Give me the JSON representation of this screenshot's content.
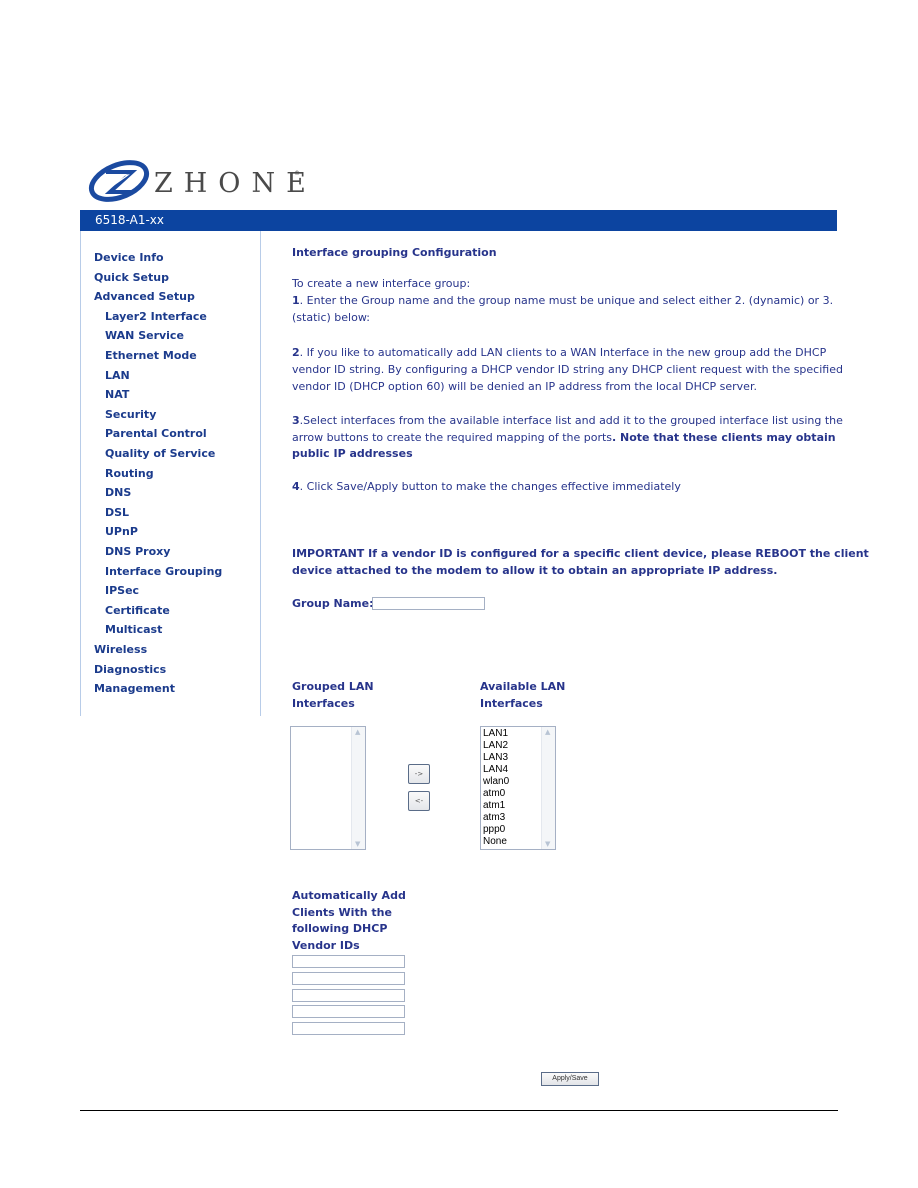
{
  "brand": {
    "name": "ZHONE",
    "reg_mark": "®"
  },
  "header": {
    "model": "6518-A1-xx"
  },
  "sidebar": {
    "items": [
      {
        "label": "Device Info",
        "level": 0
      },
      {
        "label": "Quick Setup",
        "level": 0
      },
      {
        "label": "Advanced Setup",
        "level": 0
      },
      {
        "label": "Layer2 Interface",
        "level": 1
      },
      {
        "label": "WAN Service",
        "level": 1
      },
      {
        "label": "Ethernet Mode",
        "level": 1
      },
      {
        "label": "LAN",
        "level": 1
      },
      {
        "label": "NAT",
        "level": 1
      },
      {
        "label": "Security",
        "level": 1
      },
      {
        "label": "Parental Control",
        "level": 1
      },
      {
        "label": "Quality of Service",
        "level": 1
      },
      {
        "label": "Routing",
        "level": 1
      },
      {
        "label": "DNS",
        "level": 1
      },
      {
        "label": "DSL",
        "level": 1
      },
      {
        "label": "UPnP",
        "level": 1
      },
      {
        "label": "DNS Proxy",
        "level": 1
      },
      {
        "label": "Interface Grouping",
        "level": 1
      },
      {
        "label": "IPSec",
        "level": 1
      },
      {
        "label": "Certificate",
        "level": 1
      },
      {
        "label": "Multicast",
        "level": 1
      },
      {
        "label": "Wireless",
        "level": 0
      },
      {
        "label": "Diagnostics",
        "level": 0
      },
      {
        "label": "Management",
        "level": 0
      }
    ]
  },
  "main": {
    "title": "Interface grouping Configuration",
    "intro": "To create a new interface group:",
    "step1": {
      "num": "1",
      "line1": ". Enter the Group name and the group name must be unique and select either 2. (dynamic) or 3.",
      "line2": "(static) below:"
    },
    "step2": {
      "num": "2",
      "line1": ". If you like to automatically add LAN clients to a WAN Interface in the new group add the DHCP",
      "line2": "vendor ID string. By configuring a DHCP vendor ID string any DHCP client request with the specified",
      "line3": "vendor ID (DHCP option 60) will be denied an IP address from the local DHCP server."
    },
    "step3": {
      "num": "3",
      "line1": ".Select interfaces from the available interface list and add it to the grouped interface list using the",
      "line2_plain": "arrow buttons to create the required mapping of the ports",
      "line2_bold": ". Note that these clients may obtain",
      "line3_bold": "public IP addresses"
    },
    "step4": {
      "num": "4",
      "line1": ". Click Save/Apply button to make the changes effective immediately"
    },
    "important": {
      "line1": "IMPORTANT If a vendor ID is configured for a specific client device, please REBOOT the client",
      "line2": "device attached to the modem to allow it to obtain an appropriate IP address."
    },
    "group_name": {
      "label": "Group Name:",
      "value": ""
    },
    "grouped": {
      "label1": "Grouped LAN",
      "label2": "Interfaces",
      "options": []
    },
    "available": {
      "label1": "Available LAN",
      "label2": "Interfaces",
      "options": [
        "LAN1",
        "LAN2",
        "LAN3",
        "LAN4",
        "wlan0",
        "atm0",
        "atm1",
        "atm3",
        "ppp0",
        "None"
      ]
    },
    "move_right_label": "->",
    "move_left_label": "<-",
    "vendor": {
      "line1": "Automatically Add",
      "line2": "Clients With the",
      "line3": "following DHCP",
      "line4": "Vendor IDs",
      "values": [
        "",
        "",
        "",
        "",
        ""
      ]
    },
    "apply_label": "Apply/Save"
  }
}
